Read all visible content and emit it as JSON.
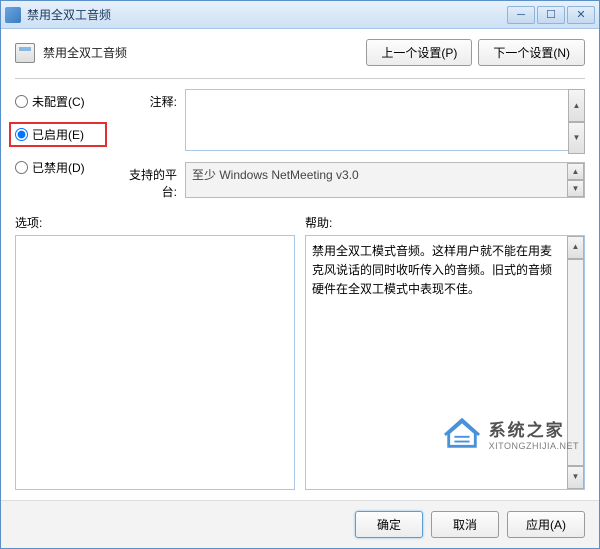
{
  "window": {
    "title": "禁用全双工音频"
  },
  "header": {
    "title": "禁用全双工音频",
    "prev_btn": "上一个设置(P)",
    "next_btn": "下一个设置(N)"
  },
  "radios": {
    "not_configured": "未配置(C)",
    "enabled": "已启用(E)",
    "disabled": "已禁用(D)",
    "selected": "enabled"
  },
  "fields": {
    "comment_label": "注释:",
    "comment_value": "",
    "platform_label": "支持的平台:",
    "platform_value": "至少 Windows NetMeeting v3.0"
  },
  "panels": {
    "options_label": "选项:",
    "help_label": "帮助:",
    "help_text": "禁用全双工模式音频。这样用户就不能在用麦克风说话的同时收听传入的音频。旧式的音频硬件在全双工模式中表现不佳。"
  },
  "footer": {
    "ok": "确定",
    "cancel": "取消",
    "apply": "应用(A)"
  },
  "watermark": {
    "cn": "系统之家",
    "en": "XITONGZHIJIA.NET"
  }
}
